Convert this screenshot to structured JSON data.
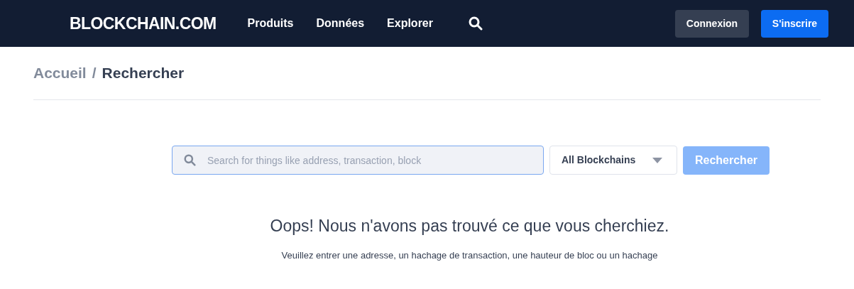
{
  "header": {
    "logo": "BLOCKCHAIN.COM",
    "nav": [
      "Produits",
      "Données",
      "Explorer"
    ],
    "buttons": [
      {
        "kind": "secondary",
        "label": "Connexion"
      },
      {
        "kind": "primary",
        "label": "S'inscrire"
      }
    ]
  },
  "breadcrumb": [
    {
      "label": "Accueil",
      "current": false
    },
    {
      "label": "/",
      "current": false
    },
    {
      "label": "Rechercher",
      "current": true
    }
  ],
  "search": {
    "placeholder": "Search for things like address, transaction, block",
    "chain_select": "All Blockchains",
    "button": {
      "label": "Rechercher",
      "disabled": true
    }
  },
  "message": {
    "title": "Oops! Nous n'avons pas trouvé ce que vous cherchiez.",
    "text": "Veuillez entrer une adresse, un hachage de transaction, une hauteur de bloc ou un hachage"
  }
}
